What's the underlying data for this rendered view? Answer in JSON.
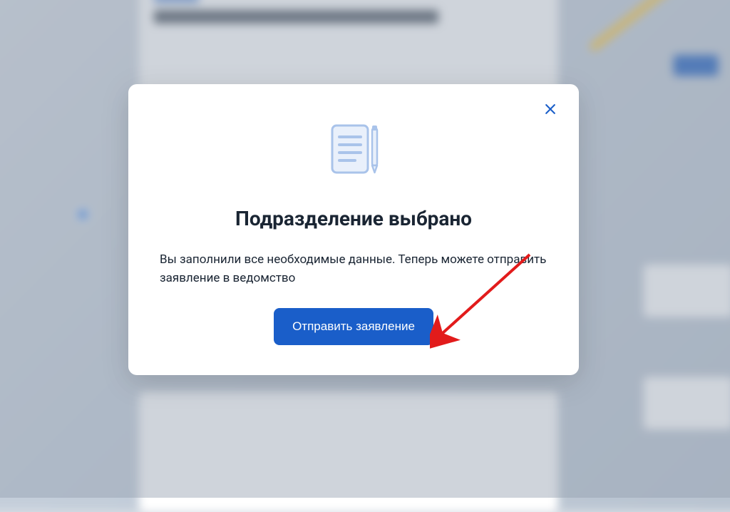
{
  "modal": {
    "title": "Подразделение выбрано",
    "description": "Вы заполнили все необходимые данные. Теперь можете отправить заявление в ведомство",
    "submit_label": "Отправить заявление"
  }
}
